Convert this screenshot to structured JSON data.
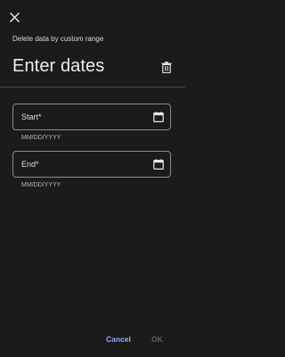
{
  "dialog": {
    "subtitle": "Delete data by custom range",
    "title": "Enter dates"
  },
  "icons": {
    "close": "close-icon",
    "delete": "trash-icon",
    "calendar": "calendar-icon"
  },
  "fields": {
    "start": {
      "label": "Start*",
      "hint": "MM/DD/YYYY",
      "value": ""
    },
    "end": {
      "label": "End*",
      "hint": "MM/DD/YYYY",
      "value": ""
    }
  },
  "actions": {
    "cancel_label": "Cancel",
    "ok_label": "OK",
    "ok_enabled": false
  },
  "colors": {
    "background": "#1b1b1b",
    "accent": "#8ab4f8",
    "disabled": "#5f5f5f",
    "outline": "#8a8a8a"
  }
}
